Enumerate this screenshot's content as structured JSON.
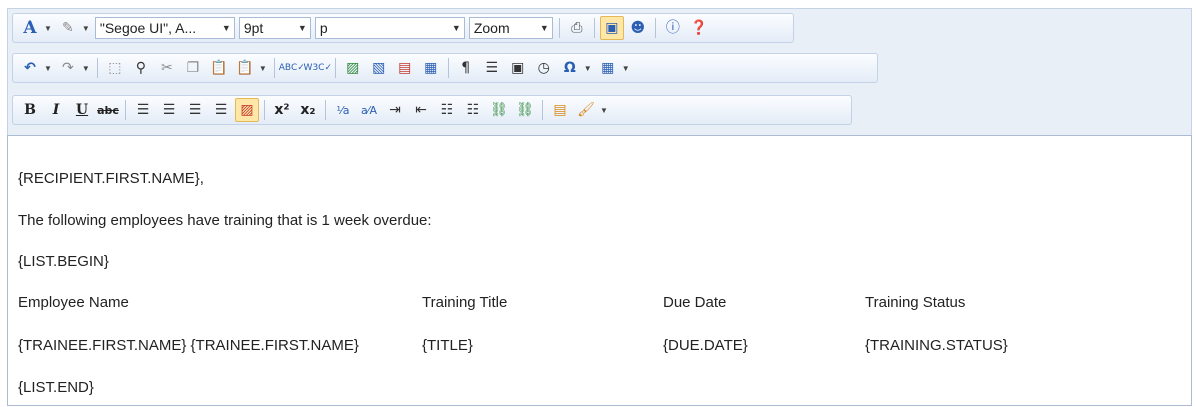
{
  "toolbar": {
    "font_name": "\"Segoe UI\", A...",
    "font_size": "9pt",
    "paragraph_style": "p",
    "zoom_label": "Zoom"
  },
  "content": {
    "greeting": "{RECIPIENT.FIRST.NAME},",
    "intro": "The following employees have training that is 1 week overdue:",
    "list_begin": " {LIST.BEGIN}",
    "table": {
      "headers": [
        "Employee Name",
        "Training Title",
        "Due Date",
        "Training Status"
      ],
      "row": [
        "{TRAINEE.FIRST.NAME} {TRAINEE.FIRST.NAME}",
        "{TITLE}",
        "{DUE.DATE}",
        "{TRAINING.STATUS}"
      ]
    },
    "list_end": "{LIST.END}"
  },
  "icons": [
    "font-color-icon",
    "highlight-icon",
    "print-icon",
    "design-view-icon",
    "user-icon",
    "info-icon",
    "help-icon",
    "undo-icon",
    "redo-icon",
    "select-all-icon",
    "find-icon",
    "cut-icon",
    "copy-icon",
    "paste-icon",
    "paste-special-icon",
    "spellcheck-icon",
    "w3c-validate-icon",
    "image-icon",
    "image-map-icon",
    "flash-icon",
    "media-icon",
    "paragraph-mark-icon",
    "horizontal-rule-icon",
    "form-icon",
    "date-time-icon",
    "special-character-icon",
    "table-icon",
    "bold-icon",
    "italic-icon",
    "underline-icon",
    "strikethrough-icon",
    "align-left-icon",
    "align-center-icon",
    "align-right-icon",
    "justify-icon",
    "remove-alignment-icon",
    "superscript-icon",
    "subscript-icon",
    "convert-lower-icon",
    "convert-upper-icon",
    "indent-icon",
    "outdent-icon",
    "numbered-list-icon",
    "bulleted-list-icon",
    "link-icon",
    "unlink-icon",
    "insert-symbol-icon",
    "format-stripper-icon"
  ]
}
